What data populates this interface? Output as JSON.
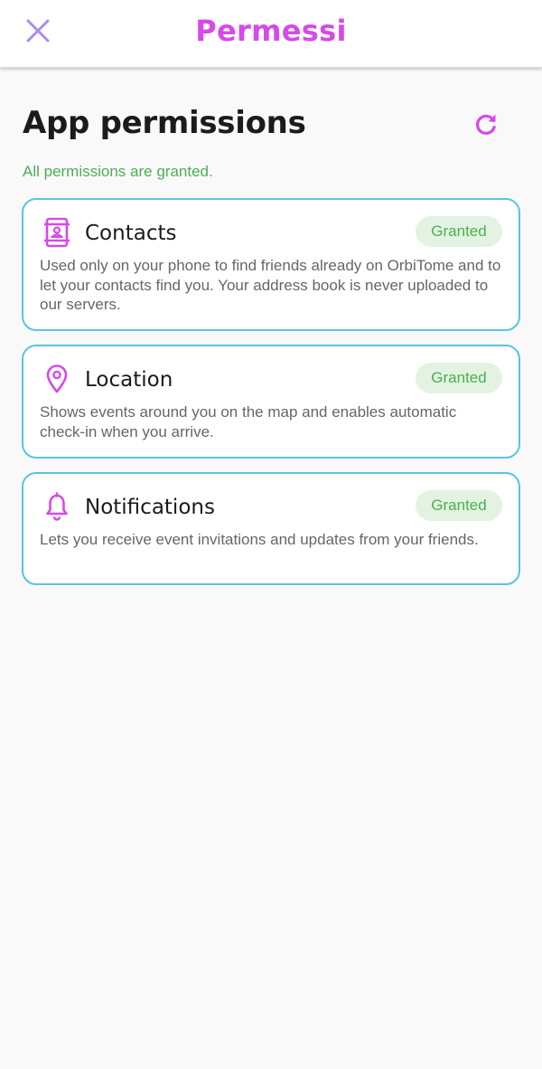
{
  "colors": {
    "accent": "#d54ae8",
    "close_icon": "#a98cf0",
    "granted": "#4caf50",
    "card_border": "#56c6de",
    "badge_bg": "#e3f3e1"
  },
  "header": {
    "title": "Permessi",
    "close_icon": "close-icon"
  },
  "main": {
    "title": "App permissions",
    "refresh_icon": "refresh-icon",
    "status": "All permissions are granted."
  },
  "permissions": [
    {
      "icon": "contacts-icon",
      "title": "Contacts",
      "status": "Granted",
      "description": "Used only on your phone to find friends already on OrbiTome and to let your contacts find you. Your address book is never uploaded to our servers."
    },
    {
      "icon": "location-pin-icon",
      "title": "Location",
      "status": "Granted",
      "description": "Shows events around you on the map and enables automatic check-in when you arrive."
    },
    {
      "icon": "bell-icon",
      "title": "Notifications",
      "status": "Granted",
      "description": "Lets you receive event invitations and updates from your friends."
    }
  ]
}
